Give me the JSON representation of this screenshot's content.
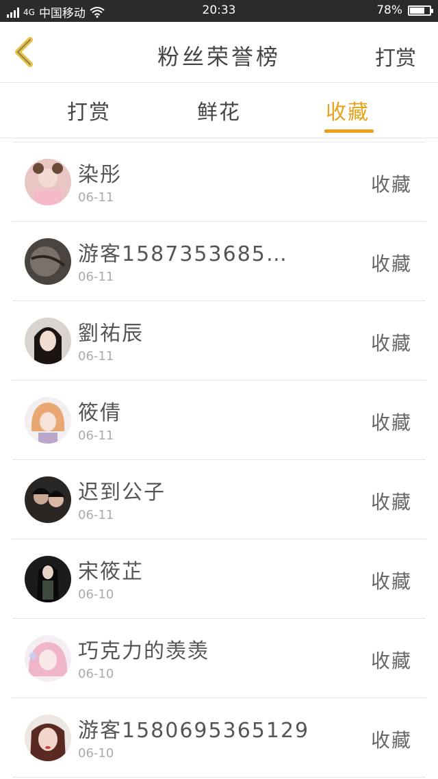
{
  "status_bar": {
    "network": "4G",
    "carrier": "中国移动",
    "time": "20:33",
    "battery": "78%",
    "battery_level": 0.78,
    "icons": [
      "signal-icon",
      "wifi-icon",
      "battery-icon"
    ]
  },
  "header": {
    "back_icon": "chevron-left-icon",
    "title": "粉丝荣誉榜",
    "right_action": "打赏"
  },
  "tabs": [
    {
      "label": "打赏",
      "active": false
    },
    {
      "label": "鲜花",
      "active": false
    },
    {
      "label": "收藏",
      "active": true
    }
  ],
  "colors": {
    "accent": "#e8a21d",
    "status_bar_bg": "#2b2b2b",
    "divider": "#e5e5e5"
  },
  "list": [
    {
      "name": "染彤",
      "date": "06-11",
      "action": "收藏"
    },
    {
      "name": "游客1587353685…",
      "date": "06-11",
      "action": "收藏"
    },
    {
      "name": "劉祐辰",
      "date": "06-11",
      "action": "收藏"
    },
    {
      "name": "筱倩",
      "date": "06-11",
      "action": "收藏"
    },
    {
      "name": "迟到公子",
      "date": "06-11",
      "action": "收藏"
    },
    {
      "name": "宋筱芷",
      "date": "06-10",
      "action": "收藏"
    },
    {
      "name": "巧克力的羡羡",
      "date": "06-10",
      "action": "收藏"
    },
    {
      "name": "游客15806953651​29",
      "date": "06-10",
      "action": "收藏"
    }
  ]
}
